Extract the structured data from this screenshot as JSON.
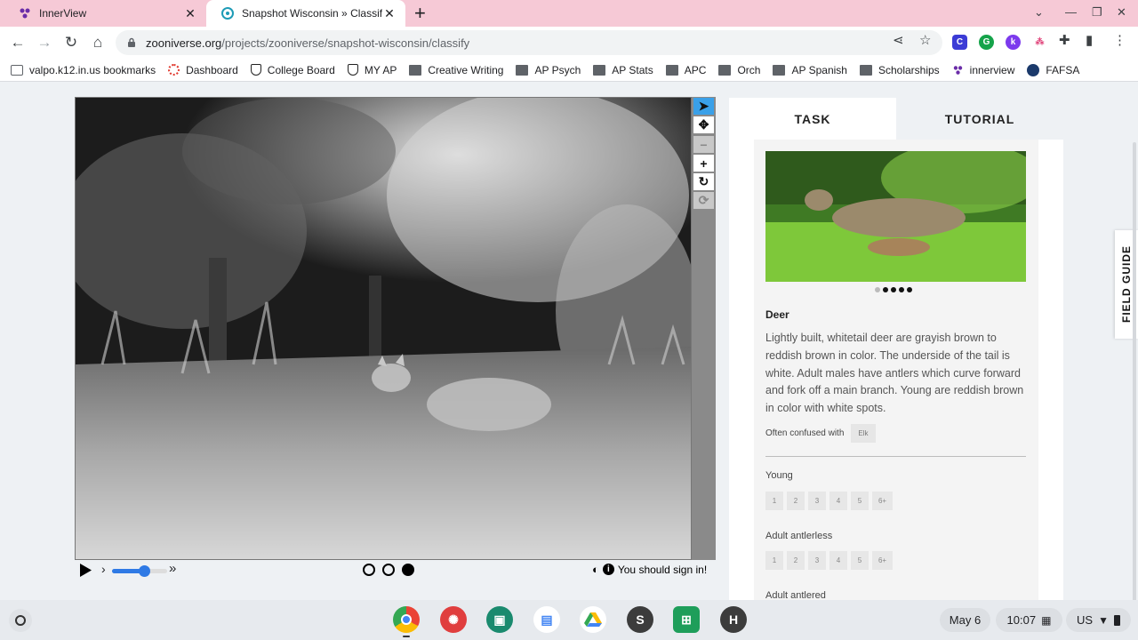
{
  "browser": {
    "tabs": [
      {
        "title": "InnerView",
        "icon": "innerview-icon"
      },
      {
        "title": "Snapshot Wisconsin » Classify",
        "icon": "zooniverse-icon",
        "active": true
      }
    ],
    "new_tab": "+",
    "url_host": "zooniverse.org",
    "url_path": "/projects/zooniverse/snapshot-wisconsin/classify"
  },
  "bookmarks": [
    {
      "label": "valpo.k12.in.us bookmarks",
      "icon": "bookmarks-folder-icon"
    },
    {
      "label": "Dashboard",
      "icon": "dashboard-icon"
    },
    {
      "label": "College Board",
      "icon": "college-board-icon"
    },
    {
      "label": "MY AP",
      "icon": "college-board-icon"
    },
    {
      "label": "Creative Writing",
      "icon": "folder-icon"
    },
    {
      "label": "AP Psych",
      "icon": "folder-icon"
    },
    {
      "label": "AP Stats",
      "icon": "folder-icon"
    },
    {
      "label": "APC",
      "icon": "folder-icon"
    },
    {
      "label": "Orch",
      "icon": "folder-icon"
    },
    {
      "label": "AP Spanish",
      "icon": "folder-icon"
    },
    {
      "label": "Scholarships",
      "icon": "folder-icon"
    },
    {
      "label": "innerview",
      "icon": "innerview-icon"
    },
    {
      "label": "FAFSA",
      "icon": "fafsa-icon"
    }
  ],
  "viewer": {
    "tools": [
      "pointer",
      "pan",
      "zoom-out",
      "zoom-in",
      "rotate",
      "reset"
    ],
    "frames": 3,
    "current_frame": 3,
    "signin_text": "You should sign in!"
  },
  "panel": {
    "tab_task": "TASK",
    "tab_tutorial": "TUTORIAL",
    "species_name": "Deer",
    "species_desc": "Lightly built, whitetail deer are grayish brown to reddish brown in color. The underside of the tail is white. Adult males have antlers which curve forward and fork off a main branch. Young are reddish brown in color with white spots.",
    "confused_label": "Often confused with",
    "confused_with": "Elk",
    "questions": [
      {
        "label": "Young",
        "options": [
          "1",
          "2",
          "3",
          "4",
          "5",
          "6+"
        ]
      },
      {
        "label": "Adult antlerless",
        "options": [
          "1",
          "2",
          "3",
          "4",
          "5",
          "6+"
        ]
      },
      {
        "label": "Adult antlered"
      }
    ],
    "field_guide": "FIELD GUIDE"
  },
  "shelf": {
    "date": "May 6",
    "time": "10:07",
    "locale": "US",
    "apps": [
      "chrome",
      "canvas",
      "classroom",
      "docs",
      "drive",
      "S",
      "sheets",
      "H"
    ]
  }
}
